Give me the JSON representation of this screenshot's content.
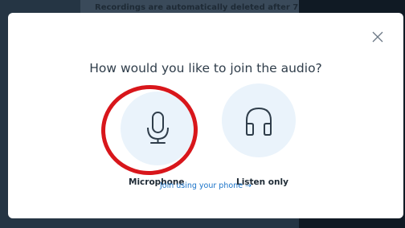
{
  "background": {
    "notice_text": "Recordings are automatically deleted after 7"
  },
  "modal": {
    "title": "How would you like to join the audio?",
    "close_icon": "close-icon",
    "options": [
      {
        "label": "Microphone",
        "icon": "microphone-icon"
      },
      {
        "label": "Listen only",
        "icon": "headphones-icon"
      }
    ],
    "phone_link": "Join using your phone →"
  },
  "colors": {
    "accent": "#1a73c8",
    "option_bg": "#eaf3fb",
    "annotation": "#d8161b"
  }
}
